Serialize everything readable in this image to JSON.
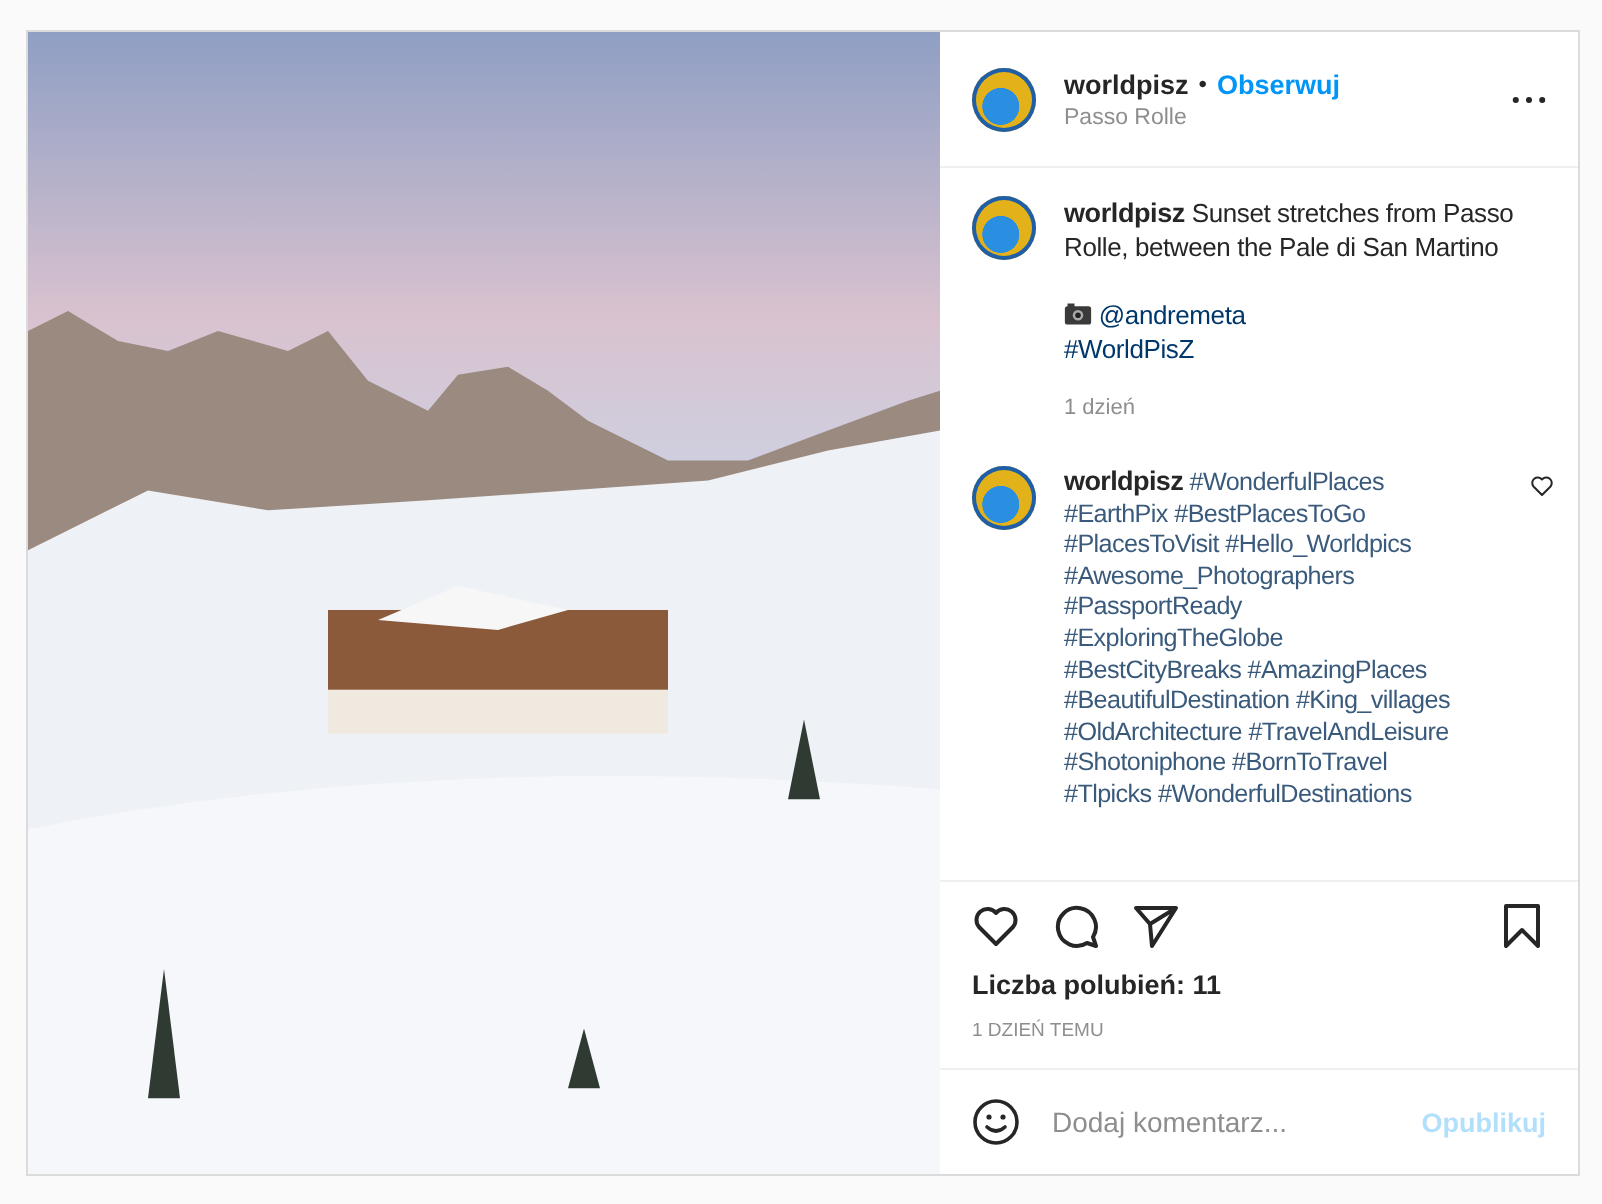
{
  "header": {
    "username": "worldpisz",
    "separator": "•",
    "follow": "Obserwuj",
    "location": "Passo Rolle"
  },
  "caption": {
    "username": "worldpisz",
    "text": "Sunset stretches from Passo Rolle, between the Pale di San Martino",
    "credit": "@andremeta",
    "hashtag": "#WorldPisZ",
    "time": "1 dzień"
  },
  "comment": {
    "username": "worldpisz",
    "liked": false,
    "hashtags": [
      "#WonderfulPlaces",
      "#EarthPix",
      "#BestPlacesToGo",
      "#PlacesToVisit",
      "#Hello_Worldpics",
      "#Awesome_Photographers",
      "#PassportReady",
      "#ExploringTheGlobe",
      "#BestCityBreaks",
      "#AmazingPlaces",
      "#BeautifulDestination",
      "#King_villages",
      "#OldArchitecture",
      "#TravelAndLeisure",
      "#Shotoniphone",
      "#BornToTravel",
      "#Tlpicks",
      "#WonderfulDestinations"
    ]
  },
  "likes": "Liczba polubień: 11",
  "date": "1 DZIEŃ TEMU",
  "comment_box": {
    "placeholder": "Dodaj komentarz...",
    "post_button": "Opublikuj",
    "post_disabled": true
  }
}
